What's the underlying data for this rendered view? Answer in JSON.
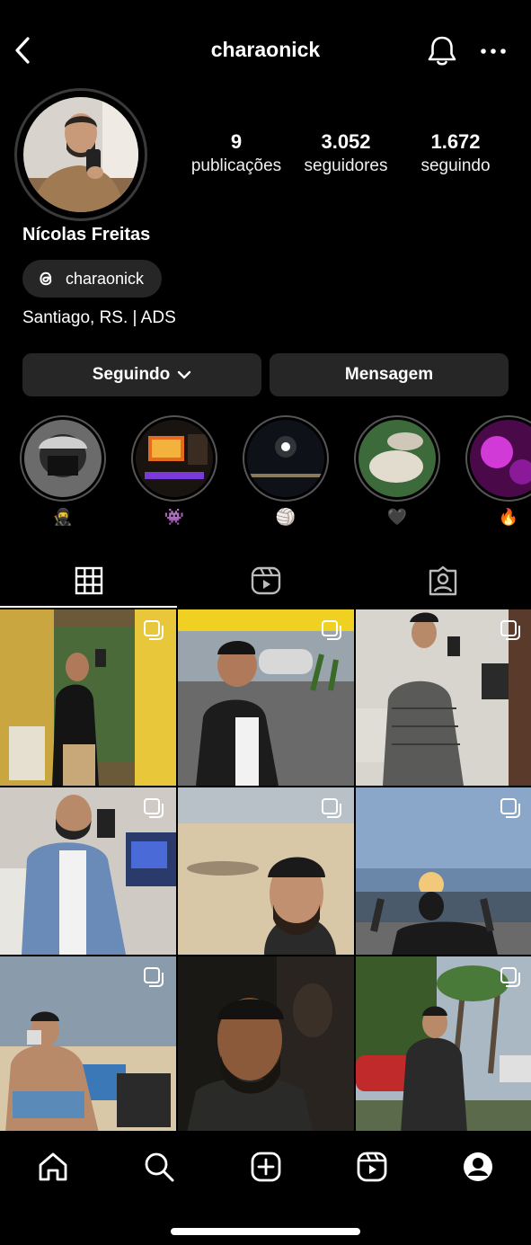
{
  "header": {
    "username": "charaonick"
  },
  "profile": {
    "full_name": "Nícolas Freitas",
    "threads_handle": "charaonick",
    "bio": "Santiago, RS. | ADS"
  },
  "stats": {
    "posts_count": "9",
    "posts_label": "publicações",
    "followers_count": "3.052",
    "followers_label": "seguidores",
    "following_count": "1.672",
    "following_label": "seguindo"
  },
  "actions": {
    "follow_label": "Seguindo",
    "message_label": "Mensagem"
  },
  "highlights": [
    {
      "label": "🥷",
      "icon": "ninja-emoji"
    },
    {
      "label": "👾",
      "icon": "alien-emoji"
    },
    {
      "label": "🏐",
      "icon": "ball-emoji"
    },
    {
      "label": "🖤",
      "icon": "black-heart-emoji"
    },
    {
      "label": "🔥",
      "icon": "fire-emoji"
    }
  ],
  "colors": {
    "background": "#000000",
    "surface": "#262626",
    "text": "#ffffff"
  },
  "icons": {
    "back": "chevron-left-icon",
    "notifications": "bell-icon",
    "more": "more-dots-icon",
    "threads": "threads-icon",
    "grid_tab": "grid-icon",
    "reels_tab": "reels-icon",
    "tagged_tab": "tagged-icon",
    "nav": [
      "home-icon",
      "search-icon",
      "add-post-icon",
      "reels-icon",
      "profile-icon"
    ]
  }
}
